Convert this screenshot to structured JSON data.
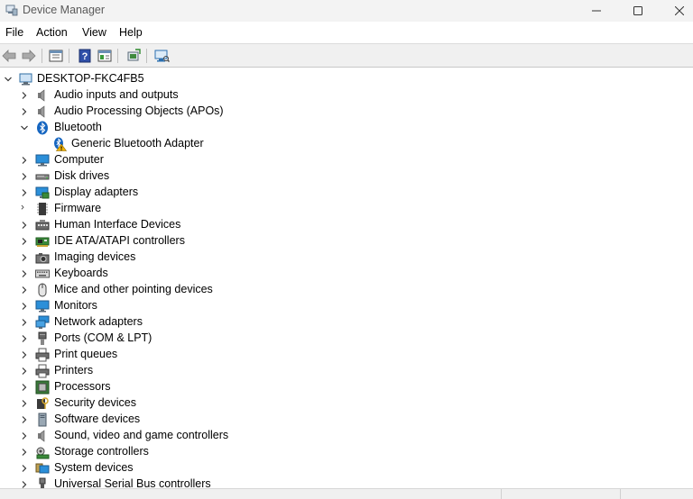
{
  "window": {
    "title": "Device Manager",
    "app_icon": "device-manager-icon"
  },
  "menu": {
    "items": [
      "File",
      "Action",
      "View",
      "Help"
    ]
  },
  "toolbar": {
    "buttons": [
      "back-arrow-icon",
      "forward-arrow-icon",
      "properties-icon",
      "help-icon",
      "show-hide-console-tree-icon",
      "update-driver-icon",
      "scan-hardware-icon"
    ]
  },
  "tree": {
    "root": "DESKTOP-FKC4FB5",
    "categories": [
      {
        "label": "Audio inputs and outputs",
        "icon": "speaker-icon",
        "expanded": false
      },
      {
        "label": "Audio Processing Objects (APOs)",
        "icon": "speaker-icon",
        "expanded": false
      },
      {
        "label": "Bluetooth",
        "icon": "bluetooth-icon",
        "expanded": true,
        "children": [
          {
            "label": "Generic Bluetooth Adapter",
            "icon": "bluetooth-warning-icon"
          }
        ]
      },
      {
        "label": "Computer",
        "icon": "computer-icon",
        "expanded": false
      },
      {
        "label": "Disk drives",
        "icon": "disk-drive-icon",
        "expanded": false
      },
      {
        "label": "Display adapters",
        "icon": "display-adapter-icon",
        "expanded": false
      },
      {
        "label": "Firmware",
        "icon": "firmware-chip-icon",
        "expanded": false
      },
      {
        "label": "Human Interface Devices",
        "icon": "hid-icon",
        "expanded": false
      },
      {
        "label": "IDE ATA/ATAPI controllers",
        "icon": "ide-controller-icon",
        "expanded": false
      },
      {
        "label": "Imaging devices",
        "icon": "camera-icon",
        "expanded": false
      },
      {
        "label": "Keyboards",
        "icon": "keyboard-icon",
        "expanded": false
      },
      {
        "label": "Mice and other pointing devices",
        "icon": "mouse-icon",
        "expanded": false
      },
      {
        "label": "Monitors",
        "icon": "monitor-icon",
        "expanded": false
      },
      {
        "label": "Network adapters",
        "icon": "network-adapter-icon",
        "expanded": false
      },
      {
        "label": "Ports (COM & LPT)",
        "icon": "port-icon",
        "expanded": false
      },
      {
        "label": "Print queues",
        "icon": "printer-icon",
        "expanded": false
      },
      {
        "label": "Printers",
        "icon": "printer-icon",
        "expanded": false
      },
      {
        "label": "Processors",
        "icon": "processor-icon",
        "expanded": false
      },
      {
        "label": "Security devices",
        "icon": "security-device-icon",
        "expanded": false
      },
      {
        "label": "Software devices",
        "icon": "software-device-icon",
        "expanded": false
      },
      {
        "label": "Sound, video and game controllers",
        "icon": "speaker-icon",
        "expanded": false
      },
      {
        "label": "Storage controllers",
        "icon": "storage-controller-icon",
        "expanded": false
      },
      {
        "label": "System devices",
        "icon": "system-devices-icon",
        "expanded": false
      },
      {
        "label": "Universal Serial Bus controllers",
        "icon": "usb-icon",
        "expanded": false
      }
    ]
  },
  "colors": {
    "bluetooth": "#1565c0",
    "monitor": "#2b8fd9",
    "warning": "#f2b300"
  }
}
